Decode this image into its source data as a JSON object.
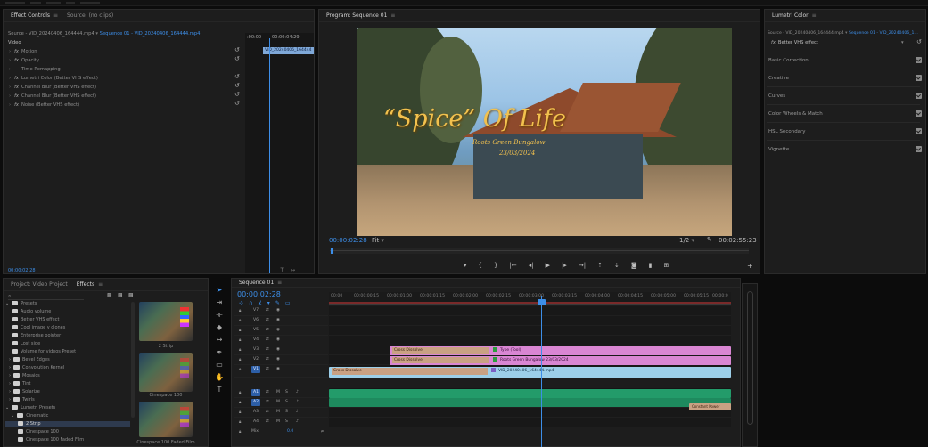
{
  "effect_controls": {
    "tabs": [
      "Effect Controls",
      "Source: (no clips)"
    ],
    "source_line": "Source - VID_20240406_164444.mp4",
    "sequence_line": "Sequence 01 - VID_20240406_164444.mp4",
    "video_header": "Video",
    "effects": [
      "Motion",
      "Opacity",
      "Time Remapping",
      "Lumetri Color (Better VHS effect)",
      "Channel Blur (Better VHS effect)",
      "Channel Blur (Better VHS effect)",
      "Noise (Better VHS effect)"
    ],
    "mini_timecodes": [
      ":00:00",
      "00:00:04:29"
    ],
    "mini_clip_label": "VID_20240406_164444",
    "timecode": "00:00:02:28"
  },
  "program_monitor": {
    "title": "Program: Sequence 01",
    "overlay_title": "“Spice” Of Life",
    "overlay_lines": [
      "Roots Green Bungalow",
      "23/03/2024"
    ],
    "current_time": "00:00:02:28",
    "fit": "Fit",
    "quality": "1/2",
    "duration": "00:02:55:23"
  },
  "lumetri": {
    "title": "Lumetri Color",
    "source_line": "Source - VID_20240406_164444.mp4",
    "sequence_line": "Sequence 01 - VID_20240406_1...",
    "effect_name": "Better VHS effect",
    "sections": [
      "Basic Correction",
      "Creative",
      "Curves",
      "Color Wheels & Match",
      "HSL Secondary",
      "Vignette"
    ]
  },
  "project": {
    "tabs": [
      "Project: Video Project",
      "Effects"
    ],
    "items": [
      "Presets",
      "Audio volume",
      "Better VHS effect",
      "Cool image y clones",
      "Enterprise pointer",
      "Lost side",
      "Volume for videos Preset",
      "Bevel Edges",
      "Convolution Kernel",
      "Mosaics",
      "Tint",
      "Solarize",
      "Twirls",
      "Lumetri Presets",
      "Cinematic",
      "2 Strip",
      "Cinespace 100",
      "Cinespace 100 Faded Film"
    ],
    "thumbs": [
      "2 Strip",
      "Cinespace 100",
      "Cinespace 100 Faded Film"
    ]
  },
  "timeline": {
    "title": "Sequence 01",
    "timecode": "00:00:02:28",
    "ticks": [
      "00:00",
      "00:00:00:15",
      "00:00:01:00",
      "00:00:01:15",
      "00:00:02:00",
      "00:00:02:15",
      "00:00:03:00",
      "00:00:03:15",
      "00:00:04:00",
      "00:00:04:15",
      "00:00:05:00",
      "00:00:05:15",
      "00:00:0"
    ],
    "video_tracks": [
      "V7",
      "V6",
      "V5",
      "V4",
      "V3",
      "V2",
      "V1"
    ],
    "audio_tracks": [
      "A1",
      "A2",
      "A3",
      "A4"
    ],
    "master": "Mix",
    "master_value": "0.0",
    "clips": {
      "cross_dissolve_1": "Cross Dissolve",
      "type_tool": "Type (Tool)",
      "cross_dissolve_2": "Cross Dissolve",
      "title_clip": "Roots Green Bungalow 23/03/2024",
      "cross_dissolve_3": "Cross Dissolve",
      "vid_clip": "VID_20240406_164444.mp4",
      "constant_power": "Constant Power"
    }
  },
  "colors": {
    "accent": "#3d8ee8",
    "clip_pink": "#d986d3",
    "clip_blue": "#9ccfe9",
    "clip_green": "#239b6a",
    "title_gold": "#f2c14e"
  }
}
